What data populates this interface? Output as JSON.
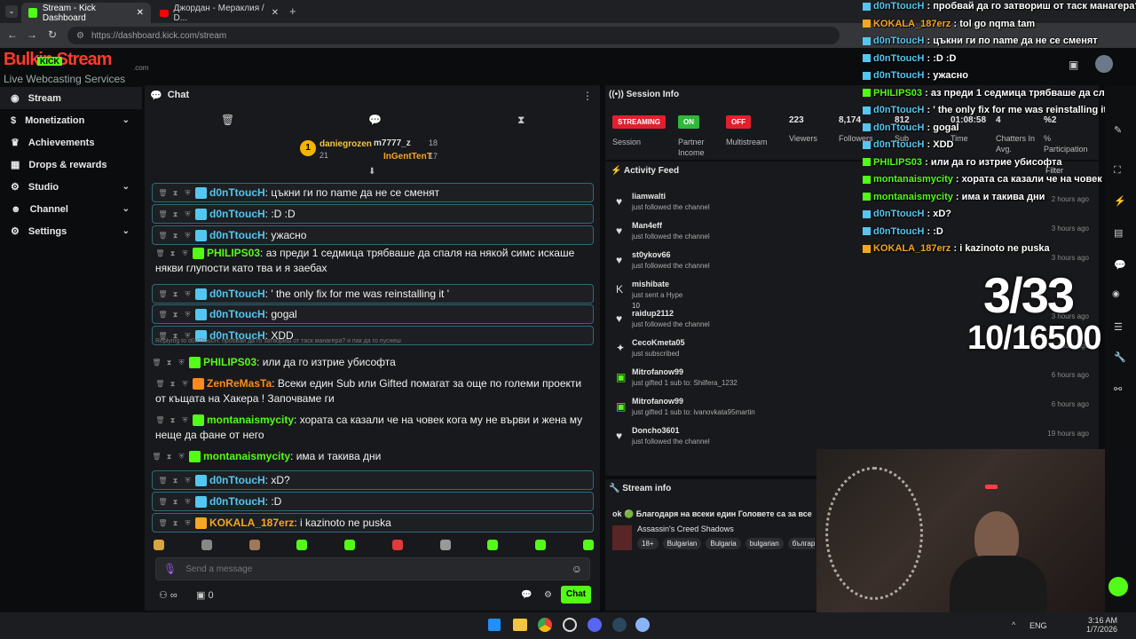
{
  "browser": {
    "tabs": [
      {
        "label": "Stream - Kick Dashboard"
      },
      {
        "label": "Джордан - Мераклия / D..."
      }
    ],
    "url": "https://dashboard.kick.com/stream"
  },
  "logo": {
    "title": "Bulkin Stream",
    "badge": "KICK",
    "subtitle": "Live Webcasting Services",
    "domain": ".com"
  },
  "sidebar": {
    "items": [
      {
        "label": "Stream",
        "icon": "broadcast-icon",
        "expandable": false
      },
      {
        "label": "Monetization",
        "icon": "dollar-icon",
        "expandable": true
      },
      {
        "label": "Achievements",
        "icon": "trophy-icon",
        "expandable": false
      },
      {
        "label": "Drops & rewards",
        "icon": "gift-icon",
        "expandable": false
      },
      {
        "label": "Studio",
        "icon": "gear-icon",
        "expandable": true
      },
      {
        "label": "Channel",
        "icon": "person-icon",
        "expandable": true
      },
      {
        "label": "Settings",
        "icon": "settings-icon",
        "expandable": true
      }
    ]
  },
  "chat": {
    "title": "Chat",
    "leaderboard": [
      {
        "rank": "1",
        "name": "daniegrozen",
        "count": "21"
      },
      {
        "name": "m7777_z",
        "count": "18"
      },
      {
        "name": "InGentTenT",
        "count": "17"
      }
    ],
    "messages": [
      {
        "user": "d0nTtoucH",
        "text": "цъкни ги по name да не се сменят",
        "color": "#54c7f0",
        "boxed": true
      },
      {
        "user": "d0nTtoucH",
        "text": ":D :D",
        "color": "#54c7f0",
        "boxed": true
      },
      {
        "user": "d0nTtoucH",
        "text": "ужасно",
        "color": "#54c7f0",
        "boxed": true
      },
      {
        "user": "PHILIPS03",
        "text": "аз преди 1 седмица трябваше да спаля на някой симс искаше някви глупости като тва и я заебах",
        "color": "#53fc18",
        "boxed": false
      },
      {
        "user": "d0nTtoucH",
        "text": "' the only fix for me was reinstalling it '",
        "color": "#54c7f0",
        "boxed": true
      },
      {
        "user": "d0nTtoucH",
        "text": "gogal",
        "color": "#54c7f0",
        "boxed": true
      },
      {
        "user": "d0nTtoucH",
        "text": "XDD",
        "color": "#54c7f0",
        "boxed": true
      },
      {
        "reply": "Replying to d0nTtoucH: пробвай да го затвориш от таск манагера? и пак да го пуснеш"
      },
      {
        "user": "PHILIPS03",
        "text": "или да го изтрие убисофта",
        "color": "#53fc18",
        "boxed": false
      },
      {
        "user": "ZenReMasTa",
        "text": "Всеки един Sub или Gifted помагат за още по големи проекти от къщата на Хакера ! Започваме ги",
        "color": "#ff8c1a",
        "boxed": false
      },
      {
        "user": "montanaismycity",
        "text": "хората са казали че на човек кога му не върви и жена му неще да фане от него",
        "color": "#53fc18",
        "boxed": false
      },
      {
        "user": "montanaismycity",
        "text": "има и такива дни",
        "color": "#53fc18",
        "boxed": false
      },
      {
        "user": "d0nTtoucH",
        "text": "xD?",
        "color": "#54c7f0",
        "boxed": true
      },
      {
        "user": "d0nTtoucH",
        "text": ":D",
        "color": "#54c7f0",
        "boxed": true
      },
      {
        "user": "KOKALA_187erz",
        "text": "i kazinoto ne puska",
        "color": "#f5a623",
        "boxed": true
      }
    ],
    "input_placeholder": "Send a message",
    "footer_count": "0",
    "send_label": "Chat"
  },
  "session": {
    "title": "Session Info",
    "items": [
      {
        "pill": "STREAMING",
        "pill_color": "#e0202e",
        "label": "Session"
      },
      {
        "pill": "ON",
        "pill_color": "#2fb83a",
        "label": "Partner Income"
      },
      {
        "pill": "OFF",
        "pill_color": "#e0202e",
        "label": "Multistream"
      }
    ],
    "stats": [
      {
        "value": "223",
        "label": "Viewers"
      },
      {
        "value": "8,174",
        "label": "Followers"
      },
      {
        "value": "812",
        "label": "Sub"
      },
      {
        "value": "01:08:58",
        "label": "Time"
      },
      {
        "value": "4",
        "label": "Chatters In Avg."
      },
      {
        "value": "%2",
        "label": "% Participation"
      }
    ]
  },
  "activity": {
    "title": "Activity Feed",
    "filter_label": "Filter",
    "items": [
      {
        "name": "liamwalti",
        "text": "just followed the channel",
        "time": "2 hours ago",
        "icon": "heart-icon"
      },
      {
        "name": "Man4eff",
        "text": "just followed the channel",
        "time": "3 hours ago",
        "icon": "heart-icon"
      },
      {
        "name": "st0ykov66",
        "text": "just followed the channel",
        "time": "3 hours ago",
        "icon": "heart-icon"
      },
      {
        "name": "mishibate",
        "text": "just sent a Hype",
        "time": "",
        "icon": "kick-icon",
        "extra": "10"
      },
      {
        "name": "raidup2112",
        "text": "just followed the channel",
        "time": "3 hours ago",
        "icon": "heart-icon"
      },
      {
        "name": "CecoKmeta05",
        "text": "just subscribed",
        "time": "6 hours ago",
        "icon": "star-icon"
      },
      {
        "name": "Mitrofanow99",
        "text": "just gifted 1 sub to: Shilfera_1232",
        "time": "6 hours ago",
        "icon": "gift-icon"
      },
      {
        "name": "Mitrofanow99",
        "text": "just gifted 1 sub to: ivanovkata95martin",
        "time": "6 hours ago",
        "icon": "gift-icon"
      },
      {
        "name": "Doncho3601",
        "text": "just followed the channel",
        "time": "19 hours ago",
        "icon": "heart-icon"
      }
    ]
  },
  "stream_info": {
    "title": "Stream info",
    "stream_title": "ok 🟢 Благодаря на всеки един Головете са за все",
    "game": "Assassin's Creed Shadows",
    "tags": [
      "18+",
      "Bulgarian",
      "Bulgaria",
      "bulgarian",
      "българ"
    ]
  },
  "overlay": {
    "messages": [
      {
        "user": "d0nTtoucH",
        "text": "пробвай да го затвориш от таск манагера? и",
        "color": "#54c7f0"
      },
      {
        "user": "KOKALA_187erz",
        "text": "tol go nqma tam",
        "color": "#f5a623"
      },
      {
        "user": "d0nTtoucH",
        "text": "цъкни ги по name да не се сменят",
        "color": "#54c7f0"
      },
      {
        "user": "d0nTtoucH",
        "text": ":D :D",
        "color": "#54c7f0"
      },
      {
        "user": "d0nTtoucH",
        "text": "ужасно",
        "color": "#54c7f0"
      },
      {
        "user": "PHILIPS03",
        "text": "аз преди 1 седмица трябваше да слаля на",
        "color": "#53fc18"
      },
      {
        "user": "d0nTtoucH",
        "text": "' the only fix for me was reinstalling it '",
        "color": "#54c7f0"
      },
      {
        "user": "d0nTtoucH",
        "text": "gogal",
        "color": "#54c7f0"
      },
      {
        "user": "d0nTtoucH",
        "text": "XDD",
        "color": "#54c7f0"
      },
      {
        "user": "PHILIPS03",
        "text": "или да го изтрие убисофта",
        "color": "#53fc18"
      },
      {
        "user": "montanaismycity",
        "text": "хората са казали че на човек кога м",
        "color": "#53fc18"
      },
      {
        "user": "montanaismycity",
        "text": "има и такива дни",
        "color": "#53fc18"
      },
      {
        "user": "d0nTtoucH",
        "text": "xD?",
        "color": "#54c7f0"
      },
      {
        "user": "d0nTtoucH",
        "text": ":D",
        "color": "#54c7f0"
      },
      {
        "user": "KOKALA_187erz",
        "text": "i kazinoto ne puska",
        "color": "#f5a623"
      }
    ],
    "counter_top": "3/33",
    "counter_bottom": "10/16500"
  },
  "taskbar": {
    "lang": "ENG",
    "time": "3:16 AM",
    "date": "1/7/2026"
  }
}
